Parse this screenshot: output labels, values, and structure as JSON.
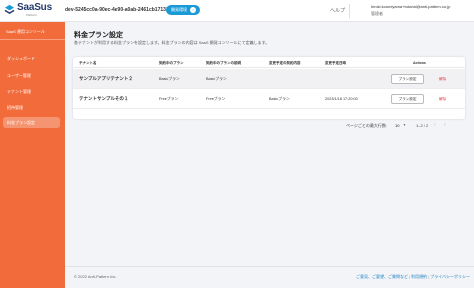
{
  "header": {
    "logo_text": "SaaSus",
    "logo_sub": "Platform",
    "env_id": "dev-5245cc0a-90ec-4e90-a0ab-2461cb171312",
    "env_badge": "開発環境",
    "help_label": "ヘルプ",
    "user_email": "hiroki.koomiyama+tutorial@anti-pattern.co.jp",
    "user_role": "管理者"
  },
  "sidebar": {
    "title": "SaaS 運用コンソール",
    "items": [
      {
        "label": "ダッシュボード",
        "active": false
      },
      {
        "label": "ユーザー管理",
        "active": false
      },
      {
        "label": "テナント管理",
        "active": false
      },
      {
        "label": "招待管理",
        "active": false
      },
      {
        "label": "料金プラン設定",
        "active": true
      }
    ]
  },
  "main": {
    "title": "料金プラン設定",
    "description": "各テナントが利用する料金プランを設定します。料金プランの内容は SaaS 開発コンソールにて定義します。"
  },
  "table": {
    "columns": [
      "テナント名",
      "契約中のプラン",
      "契約中のプランの説明",
      "変更予定の契約内容",
      "変更予定日時",
      "Actions"
    ],
    "rows": [
      {
        "name": "サンプルアプリテナント２",
        "plan": "Basicプラン",
        "plan_desc": "Basicプラン",
        "next_plan": "",
        "next_date": "",
        "plan_button": "プラン設定",
        "cancel": "解除"
      },
      {
        "name": "テナントサンプルその１",
        "plan": "Freeプラン",
        "plan_desc": "Freeプラン",
        "next_plan": "Basicプラン",
        "next_date": "2023/1/18 17:20:00",
        "plan_button": "プラン設定",
        "cancel": "解除"
      }
    ]
  },
  "pagination": {
    "label": "ページごとの最大行数:",
    "page_size": "10",
    "range": "1–2 / 2"
  },
  "footer": {
    "copyright": "© 2022 Anti-Pattern Inc.",
    "links": [
      "ご意見、ご要望、ご質問など",
      "利用規約",
      "プライバシーポリシー"
    ]
  },
  "colors": {
    "sidebar": "#f26b3a",
    "accent": "#1a9bd7",
    "danger": "#e0404a"
  }
}
